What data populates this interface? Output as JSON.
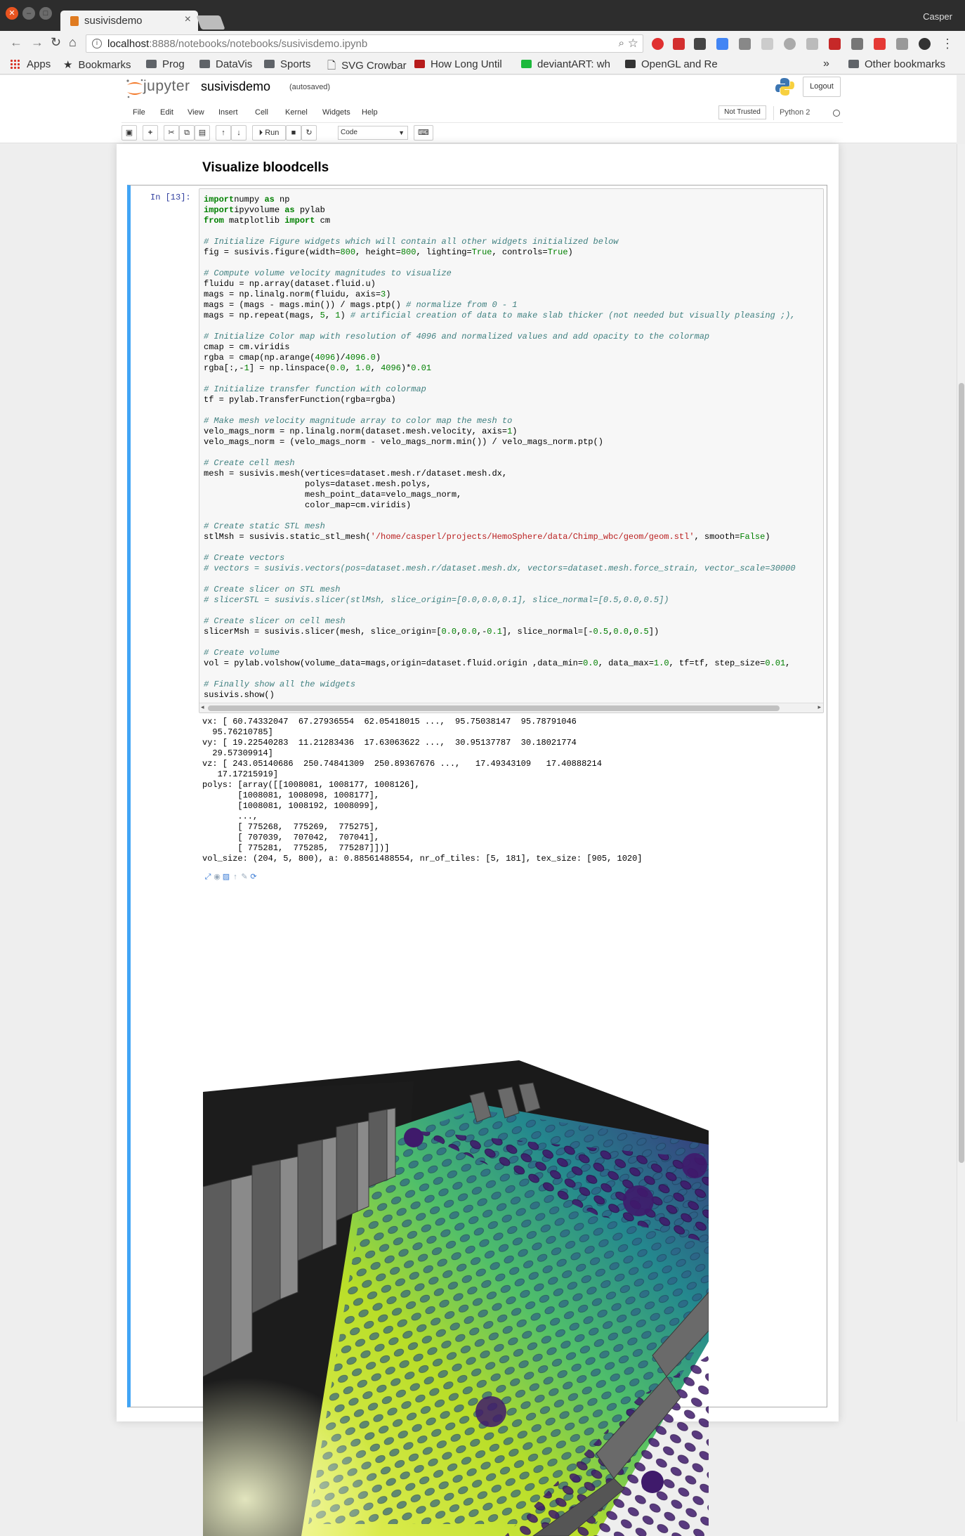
{
  "browser": {
    "tab_title": "susivisdemo",
    "profile_name": "Casper",
    "url_host": "localhost",
    "url_rest": ":8888/notebooks/notebooks/susivisdemo.ipynb",
    "bookmarks": [
      "Apps",
      "Bookmarks",
      "Prog",
      "DataVis",
      "Sports",
      "SVG Crowbar",
      "How Long Until",
      "deviantART: wh",
      "OpenGL and Re"
    ],
    "bookmarks_overflow": "»",
    "other_bookmarks": "Other bookmarks"
  },
  "jupyter": {
    "logo_text": "jupyter",
    "notebook_name": "susivisdemo",
    "autosave_status": "(autosaved)",
    "logout_label": "Logout",
    "menu": [
      "File",
      "Edit",
      "View",
      "Insert",
      "Cell",
      "Kernel",
      "Widgets",
      "Help"
    ],
    "trust_status": "Not Trusted",
    "kernel_name": "Python 2",
    "run_label": "Run",
    "cell_type": "Code"
  },
  "notebook": {
    "heading": "Visualize bloodcells",
    "prompt": "In [13]:",
    "code_lines": [
      [
        [
          "kw",
          "import"
        ],
        [
          "",
          "numpy "
        ],
        [
          "kw",
          "as"
        ],
        [
          "",
          " np"
        ]
      ],
      [
        [
          "kw",
          "import"
        ],
        [
          "",
          "ipyvolume "
        ],
        [
          "kw",
          "as"
        ],
        [
          "",
          " pylab"
        ]
      ],
      [
        [
          "kw",
          "from"
        ],
        [
          "",
          " matplotlib "
        ],
        [
          "kw",
          "import"
        ],
        [
          "",
          " cm"
        ]
      ],
      [],
      [
        [
          "cm",
          "# Initialize Figure widgets which will contain all other widgets initialized below"
        ]
      ],
      [
        [
          "",
          "fig = susivis.figure(width="
        ],
        [
          "nu",
          "800"
        ],
        [
          "",
          ", height="
        ],
        [
          "nu",
          "800"
        ],
        [
          "",
          ", lighting="
        ],
        [
          "nu",
          "True"
        ],
        [
          "",
          ", controls="
        ],
        [
          "nu",
          "True"
        ],
        [
          "",
          ")"
        ]
      ],
      [],
      [
        [
          "cm",
          "# Compute volume velocity magnitudes to visualize"
        ]
      ],
      [
        [
          "",
          "fluidu = np.array(dataset.fluid.u)"
        ]
      ],
      [
        [
          "",
          "mags = np.linalg.norm(fluidu, axis="
        ],
        [
          "nu",
          "3"
        ],
        [
          "",
          ")"
        ]
      ],
      [
        [
          "",
          "mags = (mags - mags.min()) / mags.ptp() "
        ],
        [
          "cm",
          "# normalize from 0 - 1"
        ]
      ],
      [
        [
          "",
          "mags = np.repeat(mags, "
        ],
        [
          "nu",
          "5"
        ],
        [
          "",
          ", "
        ],
        [
          "nu",
          "1"
        ],
        [
          "",
          ") "
        ],
        [
          "cm",
          "# artificial creation of data to make slab thicker (not needed but visually pleasing ;),"
        ]
      ],
      [],
      [
        [
          "cm",
          "# Initialize Color map with resolution of 4096 and normalized values and add opacity to the colormap"
        ]
      ],
      [
        [
          "",
          "cmap = cm.viridis"
        ]
      ],
      [
        [
          "",
          "rgba = cmap(np.arange("
        ],
        [
          "nu",
          "4096"
        ],
        [
          "",
          ")/"
        ],
        [
          "nu",
          "4096.0"
        ],
        [
          "",
          ")"
        ]
      ],
      [
        [
          "",
          "rgba[:,-"
        ],
        [
          "nu",
          "1"
        ],
        [
          "",
          "] = np.linspace("
        ],
        [
          "nu",
          "0.0"
        ],
        [
          "",
          ", "
        ],
        [
          "nu",
          "1.0"
        ],
        [
          "",
          ", "
        ],
        [
          "nu",
          "4096"
        ],
        [
          "",
          ")*"
        ],
        [
          "nu",
          "0.01"
        ]
      ],
      [],
      [
        [
          "cm",
          "# Initialize transfer function with colormap"
        ]
      ],
      [
        [
          "",
          "tf = pylab.TransferFunction(rgba=rgba)"
        ]
      ],
      [],
      [
        [
          "cm",
          "# Make mesh velocity magnitude array to color map the mesh to"
        ]
      ],
      [
        [
          "",
          "velo_mags_norm = np.linalg.norm(dataset.mesh.velocity, axis="
        ],
        [
          "nu",
          "1"
        ],
        [
          "",
          ")"
        ]
      ],
      [
        [
          "",
          "velo_mags_norm = (velo_mags_norm - velo_mags_norm.min()) / velo_mags_norm.ptp()"
        ]
      ],
      [],
      [
        [
          "cm",
          "# Create cell mesh"
        ]
      ],
      [
        [
          "",
          "mesh = susivis.mesh(vertices=dataset.mesh.r/dataset.mesh.dx,"
        ]
      ],
      [
        [
          "",
          "                    polys=dataset.mesh.polys,"
        ]
      ],
      [
        [
          "",
          "                    mesh_point_data=velo_mags_norm,"
        ]
      ],
      [
        [
          "",
          "                    color_map=cm.viridis)"
        ]
      ],
      [],
      [
        [
          "cm",
          "# Create static STL mesh"
        ]
      ],
      [
        [
          "",
          "stlMsh = susivis.static_stl_mesh("
        ],
        [
          "st",
          "'/home/casperl/projects/HemoSphere/data/Chimp_wbc/geom/geom.stl'"
        ],
        [
          "",
          ", smooth="
        ],
        [
          "nu",
          "False"
        ],
        [
          "",
          ")"
        ]
      ],
      [],
      [
        [
          "cm",
          "# Create vectors"
        ]
      ],
      [
        [
          "cm",
          "# vectors = susivis.vectors(pos=dataset.mesh.r/dataset.mesh.dx, vectors=dataset.mesh.force_strain, vector_scale=30000"
        ]
      ],
      [],
      [
        [
          "cm",
          "# Create slicer on STL mesh"
        ]
      ],
      [
        [
          "cm",
          "# slicerSTL = susivis.slicer(stlMsh, slice_origin=[0.0,0.0,0.1], slice_normal=[0.5,0.0,0.5])"
        ]
      ],
      [],
      [
        [
          "cm",
          "# Create slicer on cell mesh"
        ]
      ],
      [
        [
          "",
          "slicerMsh = susivis.slicer(mesh, slice_origin=["
        ],
        [
          "nu",
          "0.0"
        ],
        [
          "",
          ","
        ],
        [
          "nu",
          "0.0"
        ],
        [
          "",
          ",-"
        ],
        [
          "nu",
          "0.1"
        ],
        [
          "",
          "], slice_normal=[-"
        ],
        [
          "nu",
          "0.5"
        ],
        [
          "",
          ","
        ],
        [
          "nu",
          "0.0"
        ],
        [
          "",
          ","
        ],
        [
          "nu",
          "0.5"
        ],
        [
          "",
          "])"
        ]
      ],
      [],
      [
        [
          "cm",
          "# Create volume"
        ]
      ],
      [
        [
          "",
          "vol = pylab.volshow(volume_data=mags,origin=dataset.fluid.origin ,data_min="
        ],
        [
          "nu",
          "0.0"
        ],
        [
          "",
          ", data_max="
        ],
        [
          "nu",
          "1.0"
        ],
        [
          "",
          ", tf=tf, step_size="
        ],
        [
          "nu",
          "0.01"
        ],
        [
          "",
          ","
        ]
      ],
      [],
      [
        [
          "cm",
          "# Finally show all the widgets"
        ]
      ],
      [
        [
          "",
          "susivis.show()"
        ]
      ]
    ],
    "output_lines": [
      "vx: [ 60.74332047  67.27936554  62.05418015 ...,  95.75038147  95.78791046",
      "  95.76210785]",
      "vy: [ 19.22540283  11.21283436  17.63063622 ...,  30.95137787  30.18021774",
      "  29.57309914]",
      "vz: [ 243.05140686  250.74841309  250.89367676 ...,   17.49343109   17.40888214",
      "   17.17215919]",
      "polys: [array([[1008081, 1008177, 1008126],",
      "       [1008081, 1008098, 1008177],",
      "       [1008081, 1008192, 1008099],",
      "       ...,",
      "       [ 775268,  775269,  775275],",
      "       [ 707039,  707042,  707041],",
      "       [ 775281,  775285,  775287]])]",
      "vol_size: (204, 5, 800), a: 0.88561488554, nr_of_tiles: [5, 181], tex_size: [905, 1020]"
    ]
  },
  "colors": {
    "cell_selected_border": "#42a5f5",
    "prompt": "#303f9f",
    "keyword": "#008000",
    "comment": "#408080",
    "string": "#ba2121"
  }
}
